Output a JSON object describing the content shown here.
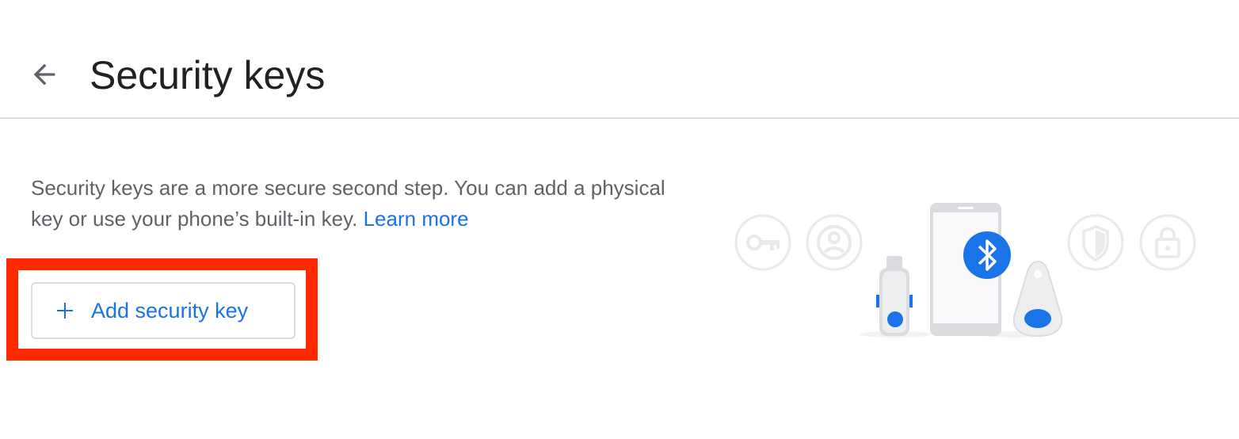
{
  "header": {
    "back_icon": "arrow-back-icon",
    "title": "Security keys"
  },
  "main": {
    "description": "Security keys are a more secure second step. You can add a physical key or use your phone’s built-in key.",
    "learn_more": "Learn more",
    "add_button": {
      "icon": "plus-icon",
      "label": "Add security key"
    }
  },
  "illustration": {
    "icons": [
      "key-icon",
      "account-icon",
      "bluetooth-icon",
      "shield-icon",
      "lock-icon"
    ],
    "devices": [
      "usb-security-key",
      "phone",
      "fob-security-key"
    ]
  },
  "colors": {
    "accent": "#1a73e8",
    "highlight": "#ff2a00",
    "text_primary": "#202124",
    "text_secondary": "#5f6368",
    "divider": "#dadce0"
  }
}
